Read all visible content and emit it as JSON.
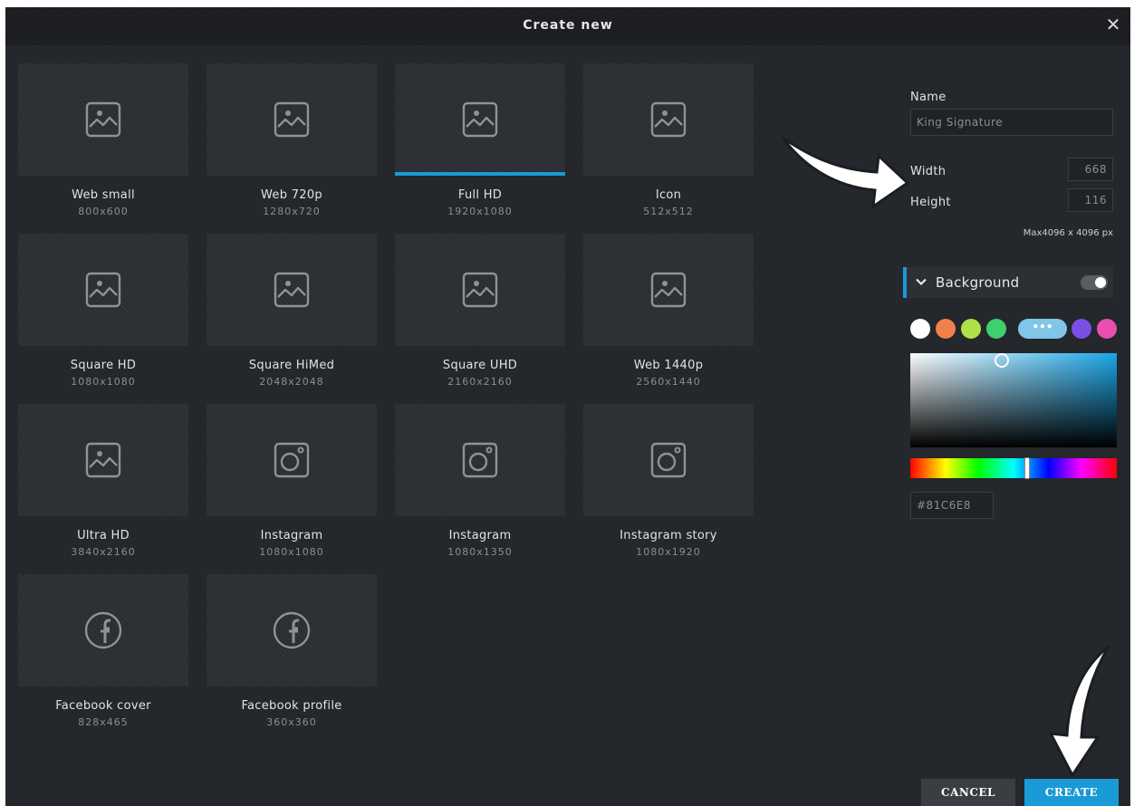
{
  "dialog": {
    "title": "Create new",
    "close_glyph": "✕"
  },
  "templates": [
    {
      "name": "Web small",
      "size": "800x600",
      "icon": "image-icon"
    },
    {
      "name": "Web 720p",
      "size": "1280x720",
      "icon": "image-icon"
    },
    {
      "name": "Full HD",
      "size": "1920x1080",
      "icon": "image-icon",
      "selected": true
    },
    {
      "name": "Icon",
      "size": "512x512",
      "icon": "image-icon"
    },
    {
      "name": "Square HD",
      "size": "1080x1080",
      "icon": "image-icon"
    },
    {
      "name": "Square HiMed",
      "size": "2048x2048",
      "icon": "image-icon"
    },
    {
      "name": "Square UHD",
      "size": "2160x2160",
      "icon": "image-icon"
    },
    {
      "name": "Web 1440p",
      "size": "2560x1440",
      "icon": "image-icon"
    },
    {
      "name": "Ultra HD",
      "size": "3840x2160",
      "icon": "image-icon"
    },
    {
      "name": "Instagram",
      "size": "1080x1080",
      "icon": "instagram-icon"
    },
    {
      "name": "Instagram",
      "size": "1080x1350",
      "icon": "instagram-icon"
    },
    {
      "name": "Instagram story",
      "size": "1080x1920",
      "icon": "instagram-icon"
    },
    {
      "name": "Facebook cover",
      "size": "828x465",
      "icon": "facebook-icon"
    },
    {
      "name": "Facebook profile",
      "size": "360x360",
      "icon": "facebook-icon"
    }
  ],
  "panel": {
    "name_label": "Name",
    "name_value": "King Signature",
    "width_label": "Width",
    "width_value": "668",
    "height_label": "Height",
    "height_value": "116",
    "max_text": "Max4096 x 4096 px",
    "background_label": "Background",
    "background_enabled": true,
    "swatches": [
      "#ffffff",
      "#f07f4a",
      "#aee04a",
      "#3fcf6f",
      "#81c6e8",
      "#7a4fe6",
      "#e84fb0"
    ],
    "more_colors_glyph": "•••",
    "hex_value": "#81C6E8"
  },
  "buttons": {
    "cancel": "CANCEL",
    "create": "CREATE"
  },
  "colors": {
    "accent": "#1a9ad6",
    "dialog_bg": "#24272b"
  }
}
